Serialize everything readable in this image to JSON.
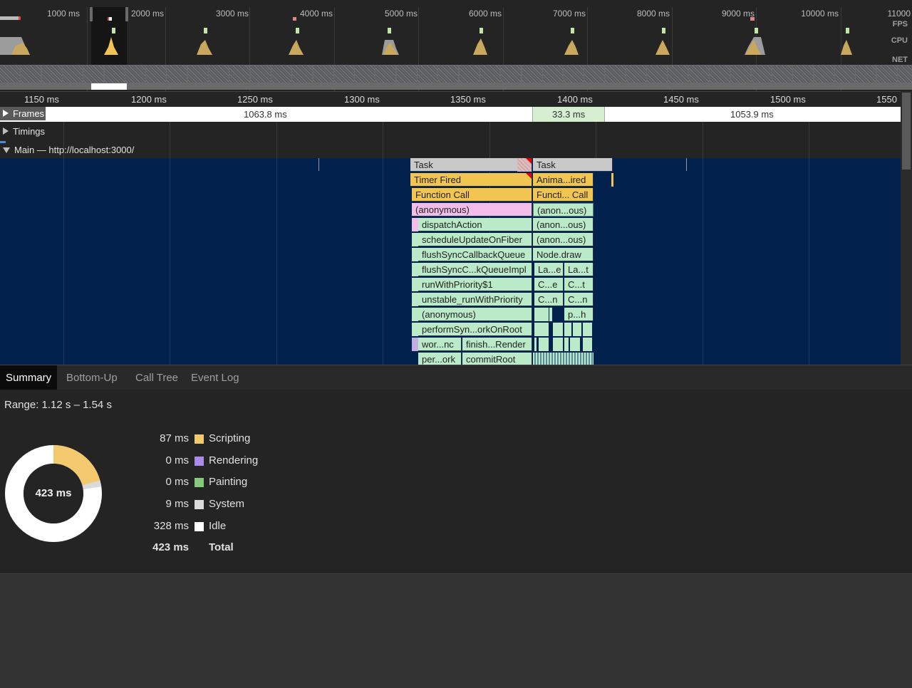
{
  "overview": {
    "ticks": [
      "1000 ms",
      "2000 ms",
      "3000 ms",
      "4000 ms",
      "5000 ms",
      "6000 ms",
      "7000 ms",
      "8000 ms",
      "9000 ms",
      "10000 ms",
      "11000"
    ],
    "lanes": {
      "fps": "FPS",
      "cpu": "CPU",
      "net": "NET"
    }
  },
  "ruler": {
    "labels": [
      "1150 ms",
      "1200 ms",
      "1250 ms",
      "1300 ms",
      "1350 ms",
      "1400 ms",
      "1450 ms",
      "1500 ms",
      "1550"
    ]
  },
  "tracks": {
    "frames": {
      "label": "Frames",
      "items": [
        "1063.8 ms",
        "33.3 ms",
        "1053.9 ms"
      ]
    },
    "timings": {
      "label": "Timings"
    },
    "main": {
      "label": "Main — http://localhost:3000/"
    }
  },
  "flame": {
    "task1": "Task",
    "task2": "Task",
    "row1": [
      "Timer Fired",
      "Anima...ired"
    ],
    "row2": [
      "Function Call",
      "Functi... Call"
    ],
    "row3": [
      "(anonymous)",
      "(anon...ous)"
    ],
    "row4": [
      "dispatchAction",
      "(anon...ous)"
    ],
    "row5": [
      "scheduleUpdateOnFiber",
      "(anon...ous)"
    ],
    "row6": [
      "flushSyncCallbackQueue",
      "Node.draw"
    ],
    "row7": [
      "flushSyncC...kQueueImpl",
      "La...e",
      "La...t"
    ],
    "row8": [
      "runWithPriority$1",
      "C...e",
      "C...t"
    ],
    "row9": [
      "unstable_runWithPriority",
      "C...n",
      "C...n"
    ],
    "row10": [
      "(anonymous)",
      "p...h"
    ],
    "row11": [
      "performSyn...orkOnRoot"
    ],
    "row12": [
      "wor...nc",
      "finish...Render"
    ],
    "row13": [
      "per...ork",
      "commitRoot"
    ]
  },
  "tabs": [
    "Summary",
    "Bottom-Up",
    "Call Tree",
    "Event Log"
  ],
  "summary": {
    "range": "Range: 1.12 s – 1.54 s",
    "total_center": "423 ms",
    "legend": [
      {
        "value": "87 ms",
        "name": "Scripting",
        "color": "#f2c96d"
      },
      {
        "value": "0 ms",
        "name": "Rendering",
        "color": "#a98ce8"
      },
      {
        "value": "0 ms",
        "name": "Painting",
        "color": "#86c97d"
      },
      {
        "value": "9 ms",
        "name": "System",
        "color": "#dadada"
      },
      {
        "value": "328 ms",
        "name": "Idle",
        "color": "#ffffff"
      }
    ],
    "total": {
      "value": "423 ms",
      "name": "Total"
    },
    "donut_fractions": {
      "scripting": 0.206,
      "system": 0.021,
      "idle": 0.773
    }
  }
}
